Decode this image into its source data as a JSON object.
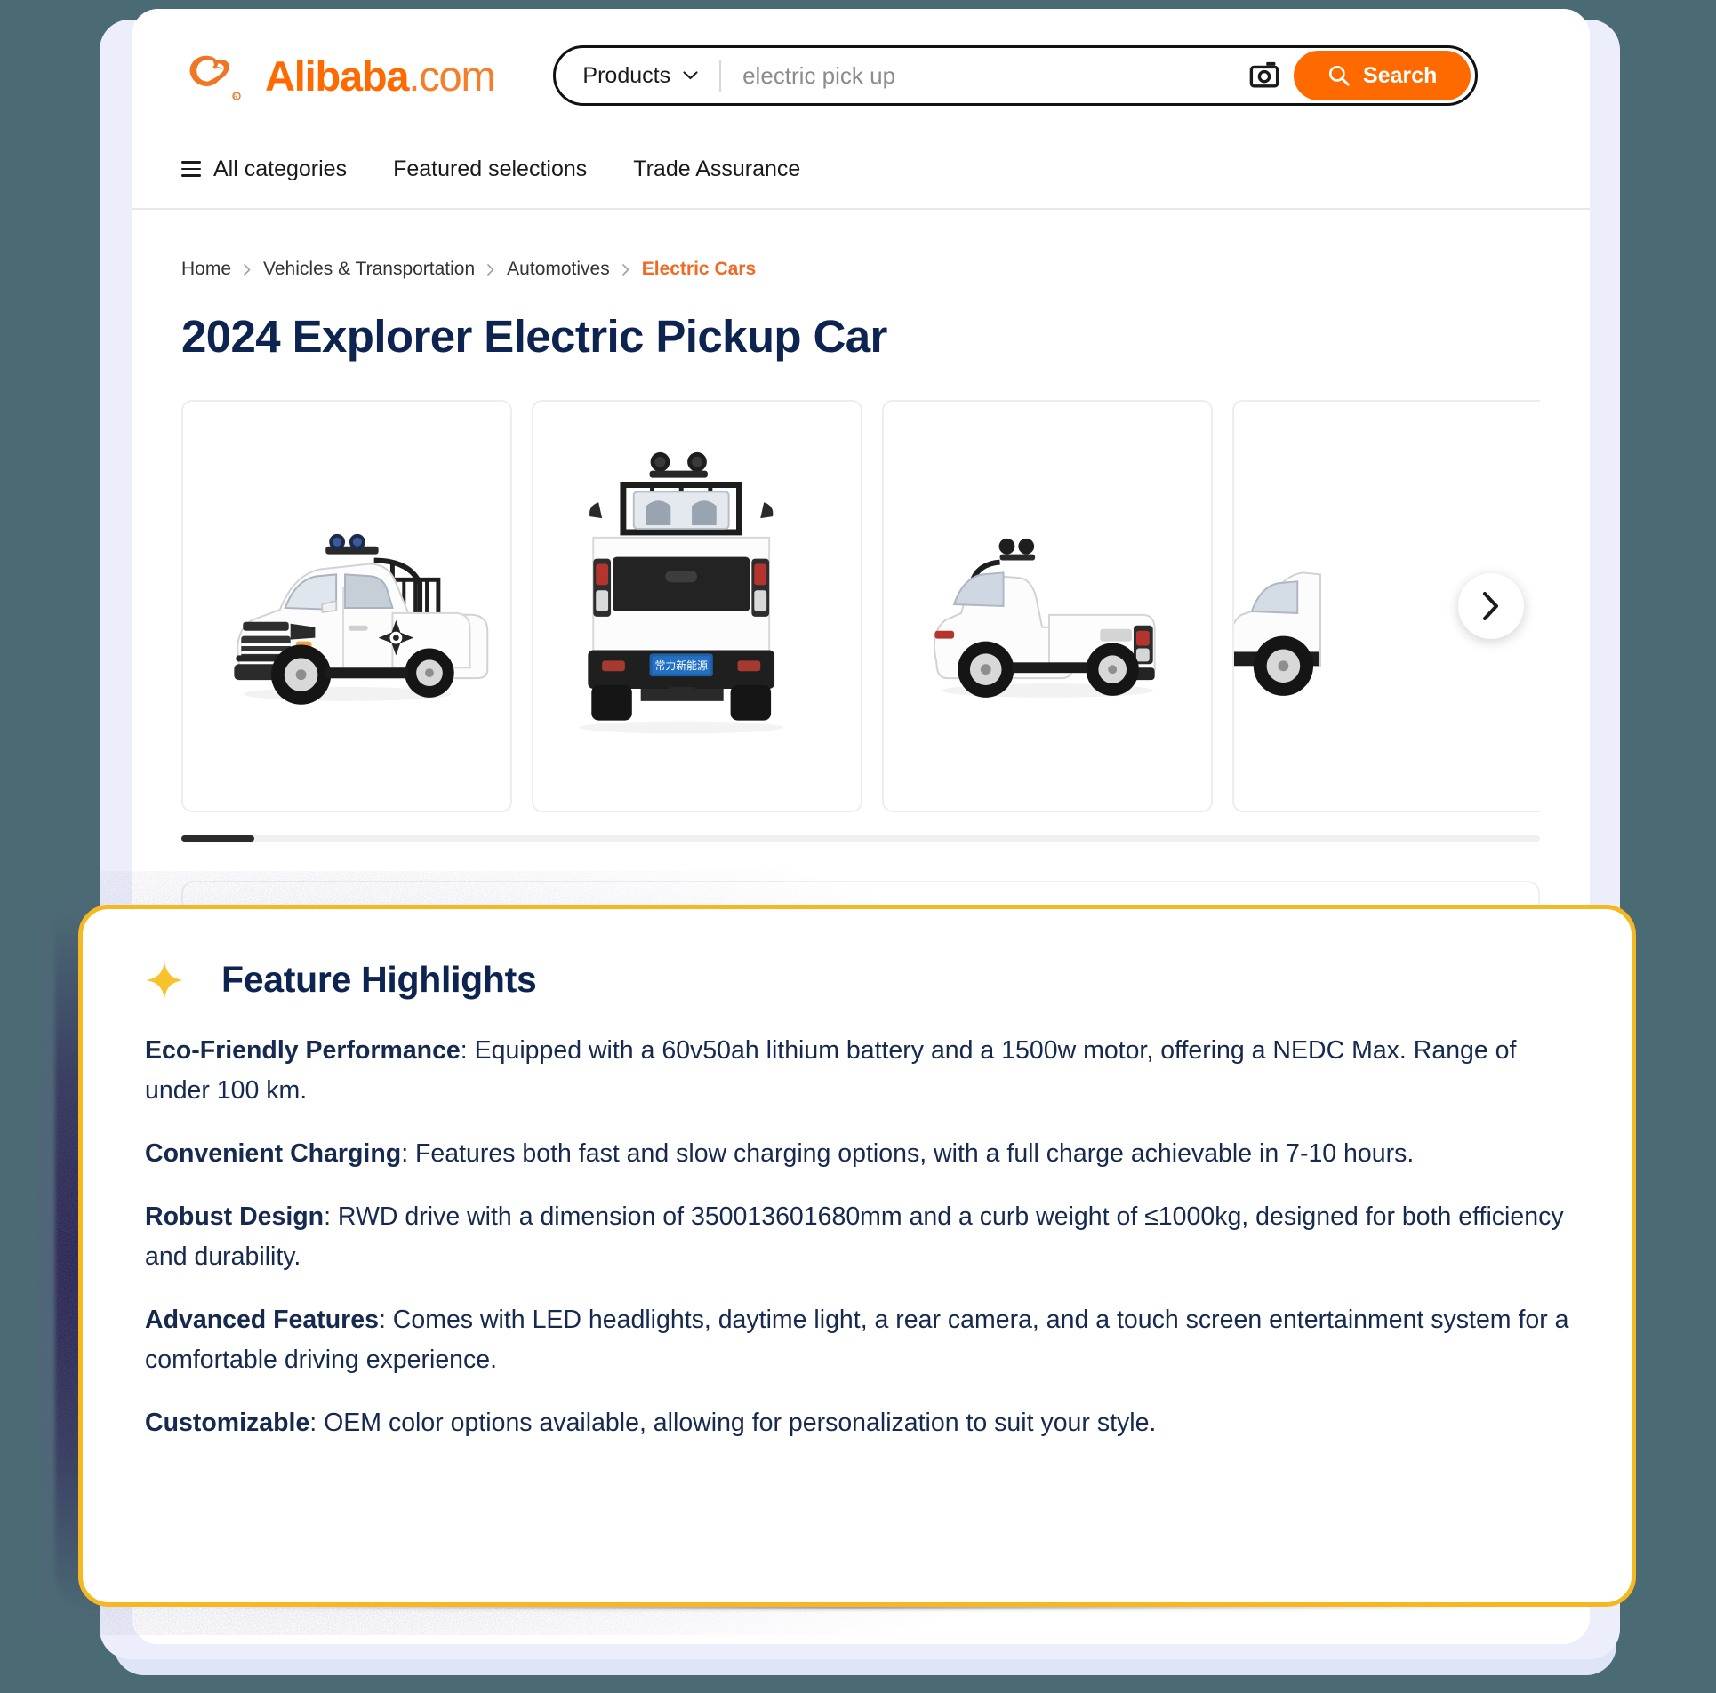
{
  "header": {
    "logo_text": "Alibaba",
    "logo_suffix": ".com",
    "search": {
      "category_label": "Products",
      "query_value": "electric pick up",
      "placeholder": "electric pick up",
      "search_button": "Search",
      "camera_icon": "camera-icon",
      "chevron_icon": "chevron-down-icon",
      "search_icon": "search-icon"
    },
    "nav": [
      {
        "label": "All categories",
        "icon": "hamburger-menu-icon"
      },
      {
        "label": "Featured selections",
        "icon": ""
      },
      {
        "label": "Trade Assurance",
        "icon": ""
      }
    ]
  },
  "breadcrumb": [
    {
      "label": "Home",
      "current": false
    },
    {
      "label": "Vehicles & Transportation",
      "current": false
    },
    {
      "label": "Automotives",
      "current": false
    },
    {
      "label": "Electric Cars",
      "current": true
    }
  ],
  "product": {
    "title": "2024 Explorer Electric Pickup Car",
    "gallery": {
      "next_icon": "chevron-right-icon",
      "images": [
        {
          "alt": "white electric pickup truck front three-quarter view"
        },
        {
          "alt": "white electric pickup truck rear view with license plate"
        },
        {
          "alt": "white electric pickup truck rear three-quarter view"
        },
        {
          "alt": "white electric pickup truck partial view"
        }
      ],
      "scroll_position": "start"
    }
  },
  "feature_highlights": {
    "icon": "sparkle-icon",
    "title": "Feature Highlights",
    "accent_color": "#f5b820",
    "text_color": "#16294f",
    "items": [
      {
        "term": "Eco-Friendly Performance",
        "body": ": Equipped with a 60v50ah lithium battery and a 1500w motor, offering a NEDC Max. Range of under 100 km."
      },
      {
        "term": "Convenient Charging",
        "body": ": Features both fast and slow charging options, with a full charge achievable in 7-10 hours."
      },
      {
        "term": "Robust Design",
        "body": ": RWD drive with a dimension of 350013601680mm and a curb weight of ≤1000kg, designed for both efficiency and durability."
      },
      {
        "term": "Advanced Features",
        "body": ": Comes with LED headlights, daytime light, a rear camera, and a touch screen entertainment system for a comfortable driving experience."
      },
      {
        "term": "Customizable",
        "body": ": OEM color options available, allowing for personalization to suit your style."
      }
    ]
  },
  "theme": {
    "page_background": "#4a6b73",
    "brand_orange": "#ff6a00",
    "title_navy": "#0d2350",
    "highlight_gold": "#f5b820"
  }
}
